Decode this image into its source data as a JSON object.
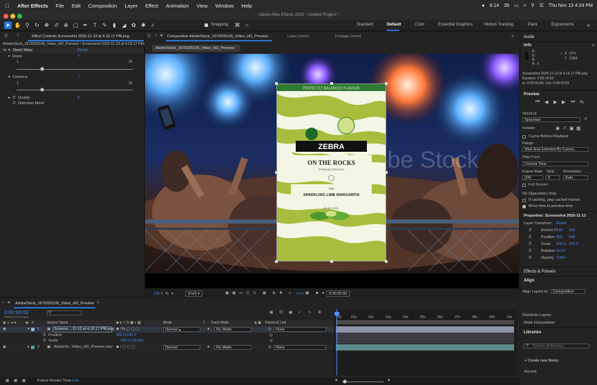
{
  "menubar": {
    "app": "After Effects",
    "items": [
      "File",
      "Edit",
      "Composition",
      "Layer",
      "Effect",
      "Animation",
      "View",
      "Window",
      "Help"
    ],
    "status_time": "6:14",
    "battery": "39",
    "datetime": "Thu Nov 13 4:24 PM"
  },
  "window": {
    "title": "Adobe After Effects 2025 - Untitled Project *"
  },
  "toolbar": {
    "snapping": "Snapping",
    "workspaces": [
      "Standard",
      "Default",
      "Color",
      "Essential Graphics",
      "Motion Tracking",
      "Paint",
      "Expressions"
    ],
    "active_workspace": "Default"
  },
  "effect_controls": {
    "tab": "Effect Controls Screenshot 2025-11-13 at 4.16.17 PM.png",
    "breadcrumb": "AdobeStock_1679335106_Video_HD_Preview • Screenshot 2025-11-13 at 4.16.17 PM.png",
    "effect_name": "Mesh Warp",
    "reset": "Reset",
    "rows_label": "Rows",
    "rows_value": "7",
    "rows_min": "1",
    "rows_max": "31",
    "columns_label": "Columns",
    "columns_value": "7",
    "columns_min": "1",
    "columns_max": "31",
    "quality_label": "Quality",
    "quality_value": "8",
    "distortion_label": "Distortion Mesh"
  },
  "composition": {
    "tab": "Composition AdobeStock_1679335106_Video_HD_Preview",
    "layer_tab": "Layer (none)",
    "footage_tab": "Footage (none)",
    "subtab": "AdobeStock_1679335106_Video_HD_Preview",
    "watermark": "Adobe Stock",
    "zoom": "126.6",
    "zoom_unit": "%",
    "resolution": "(Full)",
    "exposure": "+0.0",
    "timecode": "0:00:00:00"
  },
  "label": {
    "banner": "PERFECTLY BALANCED FLAVOUR",
    "brand": "ZEBRA",
    "tagline": "ON THE ROCKS",
    "sub": "PREMIUM COCKTAILS",
    "the": "THE",
    "product": "SPARKLING LIME MARGARITA",
    "abv": "4% ALC./VOL."
  },
  "info": {
    "header": "Audio",
    "title": "Info",
    "r": "R :",
    "g": "G :",
    "b": "B :",
    "a": "A : 0",
    "x": "X : 674",
    "y": "Y : 1063",
    "file_name": "Screenshot 2025-11-13 at 4.16.17 PM.png",
    "duration": "Duration: 0:00:10:02",
    "in_out": "In: 0:00:00:00, Out: 0:00:10:01"
  },
  "preview": {
    "title": "Preview",
    "shortcut_label": "Shortcut",
    "shortcut": "Spacebar",
    "include_label": "Include:",
    "cache": "Cache Before Playback",
    "range_label": "Range",
    "range": "Work Area Extended By Current...",
    "play_from_label": "Play From",
    "play_from": "Current Time",
    "frame_rate_label": "Frame Rate",
    "frame_rate": "(24)",
    "skip_label": "Skip",
    "skip": "0",
    "resolution_label": "Resolution",
    "resolution": "Auto",
    "full_screen": "Full Screen",
    "stop_label": "On (Spacebar) Stop:",
    "if_caching": "If caching, play cached frames",
    "move_time": "Move time to preview time"
  },
  "properties": {
    "title": "Properties: Screenshot 2025-11-13",
    "transform": "Layer Transform",
    "reset": "Reset",
    "anchor_label": "Anchor P.",
    "anchor_x": "249",
    "anchor_y": "402",
    "position_label": "Position",
    "position_x": "960",
    "position_y": "540",
    "scale_label": "Scale",
    "scale_x": "100.0",
    "scale_y": "100.0",
    "rotation_label": "Rotation",
    "rotation": "0x+0°",
    "opacity_label": "Opacity",
    "opacity": "100%"
  },
  "presets": {
    "title": "Effects & Presets"
  },
  "align": {
    "title": "Align",
    "align_to_label": "Align Layers to:",
    "align_to": "Composition",
    "distribute": "Distribute Layers:",
    "mask_interp": "Mask Interpolation"
  },
  "libraries": {
    "title": "Libraries",
    "search_placeholder": "Search all libraries",
    "create": "+ Create new library",
    "recent": "Recent"
  },
  "timeline": {
    "tab": "AdobeStock_1679335106_Video_HD_Preview",
    "timecode": "0:00:00:00",
    "fps_note": "00000 (24.00 fps)",
    "headers": {
      "source": "Source Name",
      "mode": "Mode",
      "t": "T",
      "track_matte": "Track Matte",
      "parent": "Parent & Link"
    },
    "layers": [
      {
        "num": "1",
        "name": "Screens...-11-13 at 4.16.17 PM.png",
        "mode": "Normal",
        "matte": "No Matte",
        "parent": "None"
      },
      {
        "num": "2",
        "name": "AdobeSt...Video_HD_Preview.mov",
        "mode": "Normal",
        "matte": "No Matte",
        "parent": "None"
      }
    ],
    "position_prop": "Position",
    "position_val": "960.0,540.0",
    "scale_prop": "Scale",
    "scale_val": "100.0,100.0%",
    "ruler": [
      "0s",
      "01s",
      "02s",
      "03s",
      "04s",
      "05s",
      "06s",
      "07s",
      "08s",
      "09s",
      "10s"
    ],
    "render_time_label": "Frame Render Time:",
    "render_time": "1ms"
  },
  "colors": {
    "accent": "#2d74d8",
    "value_blue": "#4c8ef7",
    "label_green": "#b6c84a",
    "banner_green": "#2f7a33"
  }
}
